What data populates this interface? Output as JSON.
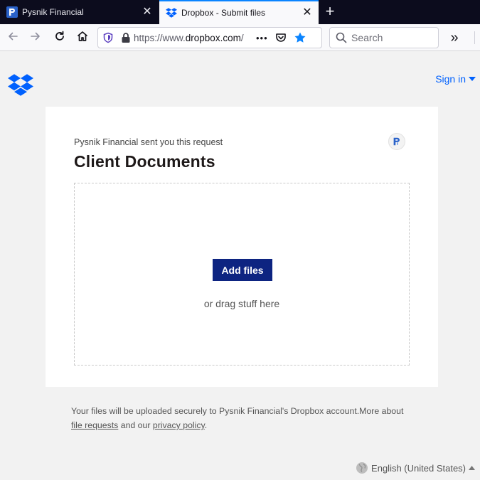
{
  "tabs": [
    {
      "title": "Pysnik Financial",
      "close": "✕",
      "active": false
    },
    {
      "title": "Dropbox - Submit files",
      "close": "✕",
      "active": true
    }
  ],
  "new_tab_label": "+",
  "navbar": {
    "url_prefix": "https://www.",
    "url_domain": "dropbox.com",
    "url_rest": "/",
    "page_actions": "•••",
    "search_placeholder": "Search",
    "overflow": "»"
  },
  "header": {
    "signin_label": "Sign in"
  },
  "request": {
    "sender_line": "Pysnik Financial sent you this request",
    "title": "Client Documents",
    "add_files_label": "Add files",
    "drag_text": "or drag stuff here"
  },
  "footer": {
    "note_part1": "Your files will be uploaded securely to Pysnik Financial's Dropbox account.More about ",
    "file_requests_link": "file requests",
    "note_part2": " and our ",
    "privacy_link": "privacy policy",
    "note_part3": ".",
    "language_label": "English (United States)"
  },
  "colors": {
    "brand_blue": "#0061fe",
    "button_navy": "#0d2481",
    "tab_accent": "#0a84ff",
    "star_blue": "#0a84ff"
  }
}
